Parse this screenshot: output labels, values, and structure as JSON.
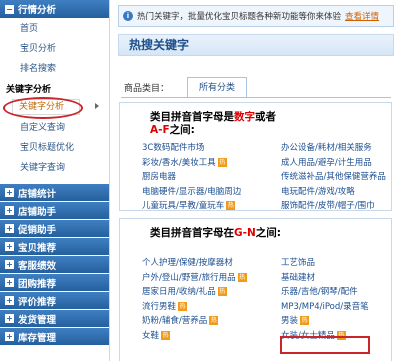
{
  "sidebar": {
    "top_header": "行情分析",
    "items": [
      "首页",
      "宝贝分析",
      "排名搜索"
    ],
    "category": "关键字分析",
    "active_item": "关键字分析",
    "sub_items": [
      "自定义查询",
      "宝贝标题优化",
      "关键字查询"
    ],
    "sections": [
      "店铺统计",
      "店铺助手",
      "促销助手",
      "宝贝推荐",
      "客服绩效",
      "团购推荐",
      "评价推荐",
      "发货管理",
      "库存管理"
    ]
  },
  "notice": {
    "text": "热门关键字，批量优化宝贝标题各种新功能等你来体验",
    "link": "查看详情"
  },
  "title": "热搜关键字",
  "tabs": {
    "label": "商品类目：",
    "items": [
      "所有分类"
    ]
  },
  "groups": [
    {
      "head_prefix": "类目拼音首字母是",
      "head_red": "数字",
      "head_mid": "或者",
      "head_letters": "A-F",
      "head_suffix": "之间:",
      "cells": [
        {
          "text": "3C数码配件市场",
          "hot": false
        },
        {
          "text": "办公设备/耗材/相关服务",
          "hot": false
        },
        {
          "text": "彩妆/香水/美妆工具",
          "hot": true
        },
        {
          "text": "成人用品/避孕/计生用品",
          "hot": false
        },
        {
          "text": "厨房电器",
          "hot": false
        },
        {
          "text": "传统滋补品/其他保健营养品",
          "hot": false
        },
        {
          "text": "电脑硬件/显示器/电脑周边",
          "hot": false
        },
        {
          "text": "电玩配件/游戏/攻略",
          "hot": false
        },
        {
          "text": "儿童玩具/早教/童玩车",
          "hot": true
        },
        {
          "text": "服饰配件/皮带/帽子/围巾",
          "hot": false
        }
      ]
    },
    {
      "head_prefix": "类目拼音首字母在",
      "head_letters": "G-N",
      "head_suffix": "之间:",
      "cells": [
        {
          "text": "个人护理/保健/按摩器材",
          "hot": false
        },
        {
          "text": "工艺饰品",
          "hot": false
        },
        {
          "text": "户外/登山/野营/旅行用品",
          "hot": true
        },
        {
          "text": "基础建材",
          "hot": false
        },
        {
          "text": "居家日用/收纳/礼品",
          "hot": true
        },
        {
          "text": "乐器/吉他/钢琴/配件",
          "hot": false
        },
        {
          "text": "流行男鞋",
          "hot": true
        },
        {
          "text": "MP3/MP4/iPod/录音笔",
          "hot": false
        },
        {
          "text": "奶粉/辅食/营养品",
          "hot": true
        },
        {
          "text": "男装",
          "hot": true
        },
        {
          "text": "女鞋",
          "hot": true
        },
        {
          "text": "女装/女士精品",
          "hot": true
        }
      ]
    }
  ],
  "hot_badge": "热",
  "colors": {
    "accent": "#2a64a3",
    "highlight": "#c8262a",
    "link": "#1d4f91",
    "badge": "#f09c1a"
  }
}
